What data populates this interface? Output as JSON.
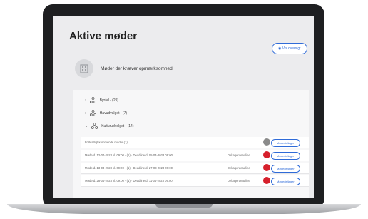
{
  "page": {
    "title": "Aktive møder",
    "view_button": "Vis oversigt"
  },
  "attention": {
    "label": "Møder der kræver opmærksomhed"
  },
  "groups": [
    {
      "label": "Byråd - (29)",
      "expanded": false
    },
    {
      "label": "Havudvalget - (7)",
      "expanded": false
    },
    {
      "label": "Kulturudvalget - (14)",
      "expanded": true
    }
  ],
  "rows": [
    {
      "text": "Forklarligt kommende møder (1)",
      "status": "",
      "dot_color": "#8a8a8a",
      "button": "Mødedeltager"
    },
    {
      "text": "Møde d. 12-04-2023 kl. 09:00 - (1) · Deadline d. 05-04-2023 09:00",
      "status": "Deltagerdeadline",
      "dot_color": "#d6202c",
      "button": "Mødedeltager"
    },
    {
      "text": "Møde d. 13-04-2023 kl. 09:00 - (1) · Deadline d. 27-03-2023 09:00",
      "status": "Deltagerdeadline",
      "dot_color": "#d6202c",
      "button": "Mødedeltager"
    },
    {
      "text": "Møde d. 28-04-2023 kl. 09:00 - (1) · Deadline d. 11-04-2023 09:00",
      "status": "Deltagerdeadline",
      "dot_color": "#d6202c",
      "button": "Mødedeltager"
    }
  ]
}
